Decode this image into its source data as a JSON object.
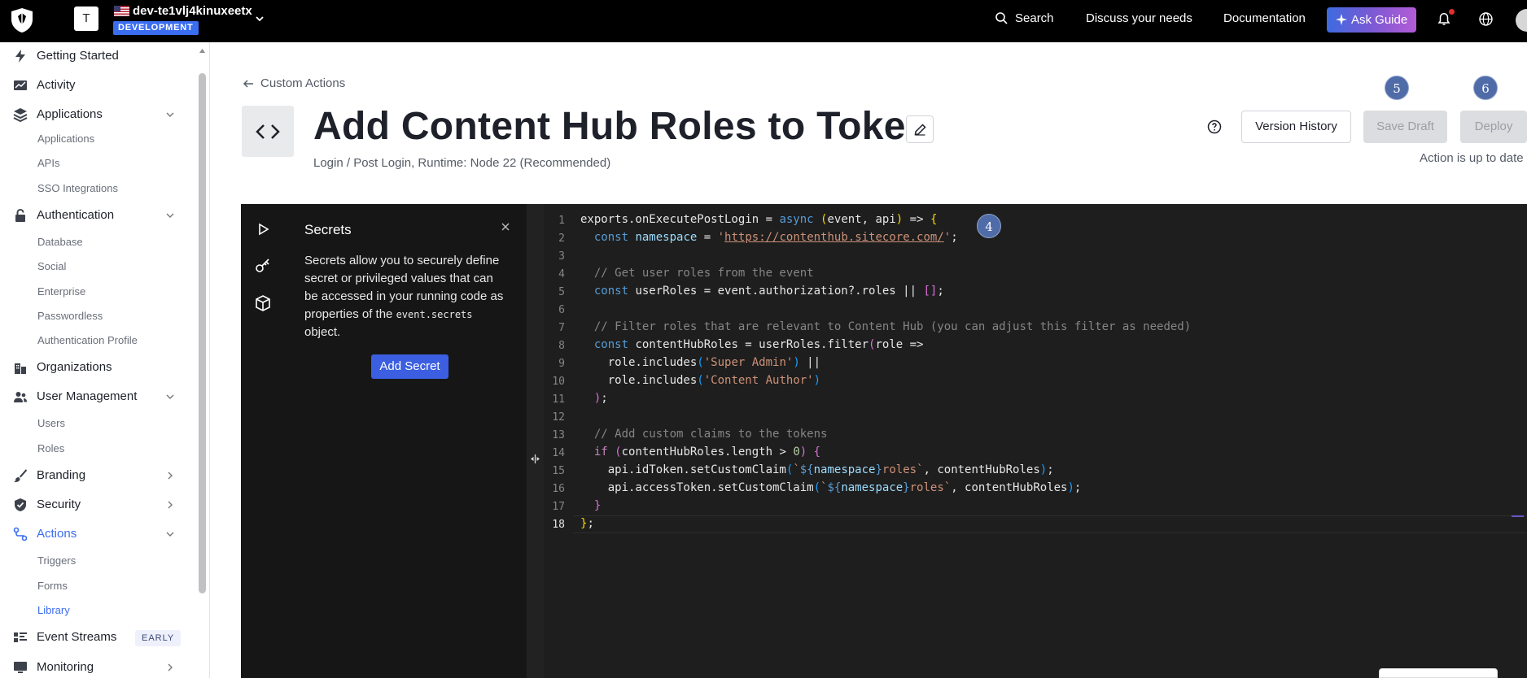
{
  "topbar": {
    "tenant_initial": "T",
    "tenant_name": "dev-te1vlj4kinuxeetx",
    "environment": "DEVELOPMENT",
    "search_label": "Search",
    "discuss_label": "Discuss your needs",
    "docs_label": "Documentation",
    "ask_guide_label": "Ask Guide",
    "icons": [
      "logo-icon",
      "flag-icon",
      "chevron-down-icon",
      "search-icon",
      "sparkle-icon",
      "bell-icon",
      "globe-icon"
    ]
  },
  "sidebar": {
    "items": [
      {
        "label": "Getting Started",
        "icon": "bolt-icon"
      },
      {
        "label": "Activity",
        "icon": "chart-line-icon"
      },
      {
        "label": "Applications",
        "icon": "layers-icon"
      },
      {
        "label": "Authentication",
        "icon": "lock-icon"
      },
      {
        "label": "Organizations",
        "icon": "buildings-icon"
      },
      {
        "label": "User Management",
        "icon": "users-icon"
      },
      {
        "label": "Branding",
        "icon": "brush-icon"
      },
      {
        "label": "Security",
        "icon": "shield-check-icon"
      },
      {
        "label": "Actions",
        "icon": "flow-icon"
      },
      {
        "label": "Event Streams",
        "icon": "stream-icon",
        "badge": "EARLY"
      },
      {
        "label": "Monitoring",
        "icon": "monitor-icon"
      }
    ],
    "applications_sub": [
      "Applications",
      "APIs",
      "SSO Integrations"
    ],
    "authentication_sub": [
      "Database",
      "Social",
      "Enterprise",
      "Passwordless",
      "Authentication Profile"
    ],
    "user_management_sub": [
      "Users",
      "Roles"
    ],
    "actions_sub": [
      "Triggers",
      "Forms",
      "Library"
    ],
    "active_item": "Actions",
    "active_sub": "Library"
  },
  "header": {
    "breadcrumb": "Custom Actions",
    "title": "Add Content Hub Roles to Toke",
    "subtitle": "Login / Post Login, Runtime: Node 22 (Recommended)",
    "version_history_label": "Version History",
    "save_draft_label": "Save Draft",
    "deploy_label": "Deploy",
    "status": "Action is up to date"
  },
  "markers": [
    "5",
    "6",
    "4"
  ],
  "secrets": {
    "title": "Secrets",
    "description_before": "Secrets allow you to securely define secret or privileged values that can be accessed in your running code as properties of the ",
    "description_code": "event.secrets",
    "description_after": " object.",
    "add_label": "Add Secret"
  },
  "editor": {
    "line_numbers": [
      "1",
      "2",
      "3",
      "4",
      "5",
      "6",
      "7",
      "8",
      "9",
      "10",
      "11",
      "12",
      "13",
      "14",
      "15",
      "16",
      "17",
      "18"
    ],
    "current_line": "18",
    "code": [
      "exports.onExecutePostLogin = async (event, api) => {",
      "  const namespace = 'https://contenthub.sitecore.com/';",
      "",
      "  // Get user roles from the event",
      "  const userRoles = event.authorization?.roles || [];",
      "",
      "  // Filter roles that are relevant to Content Hub (you can adjust this filter as needed)",
      "  const contentHubRoles = userRoles.filter(role =>",
      "    role.includes('Super Admin') ||",
      "    role.includes('Content Author')",
      "  );",
      "",
      "  // Add custom claims to the tokens",
      "  if (contentHubRoles.length > 0) {",
      "    api.idToken.setCustomClaim(`${namespace}roles`, contentHubRoles);",
      "    api.accessToken.setCustomClaim(`${namespace}roles`, contentHubRoles);",
      "  }",
      "};"
    ]
  },
  "colors": {
    "accent": "#3b6df0",
    "editor_bg": "#1e1e1e",
    "marker": "#4f6ca8"
  }
}
